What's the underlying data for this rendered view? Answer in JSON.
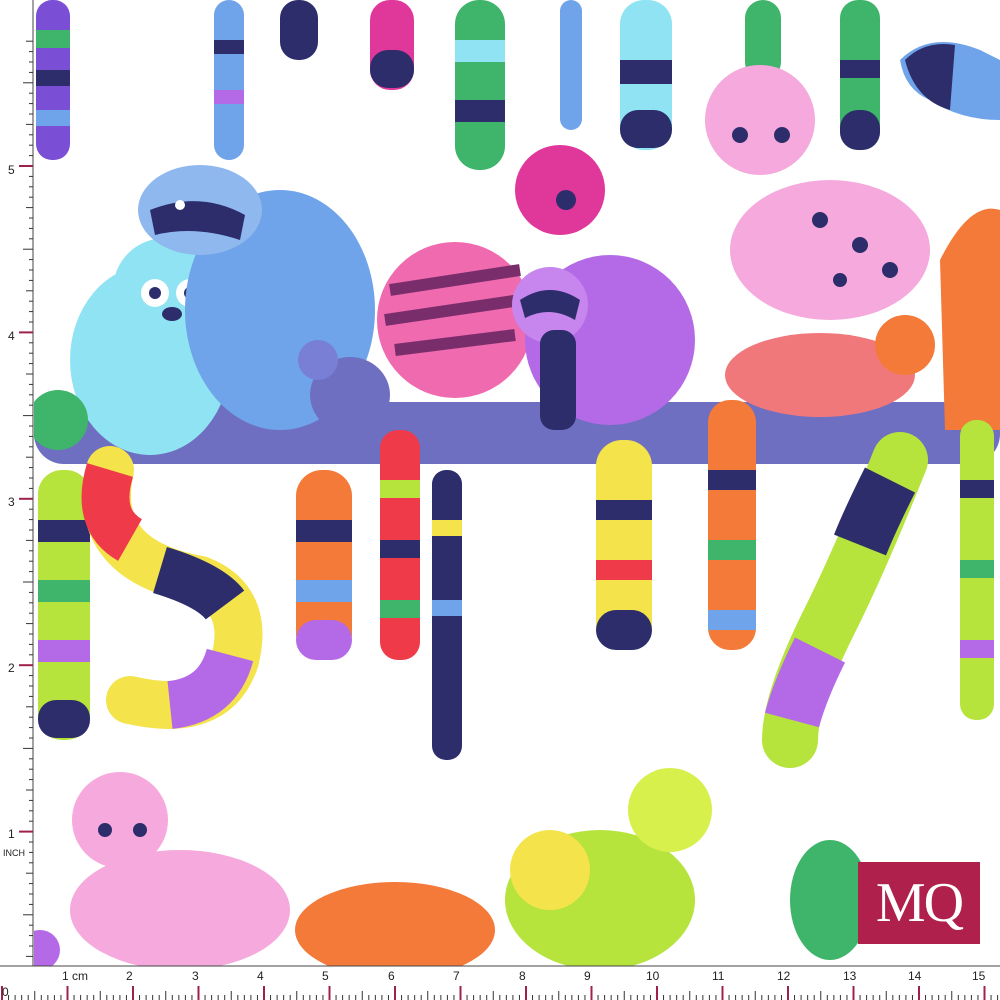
{
  "image": {
    "description_subject": "fabric swatch",
    "palette": {
      "background": "#ffffff",
      "branch": "#6f6fc2",
      "navy": "#2d2d6b",
      "pink": "#f06ab0",
      "magenta": "#e0379b",
      "purple": "#b46ae6",
      "blue": "#6fa4ea",
      "cyan": "#8fe3f2",
      "orange": "#f47a3a",
      "coral": "#f0787a",
      "yellow": "#f4e34a",
      "lime": "#b6e33c",
      "green": "#3fb46b",
      "red": "#ef3a4a"
    }
  },
  "ruler": {
    "inch_unit": "INCH",
    "cm_unit": "cm",
    "inch_marks": [
      "5",
      "4",
      "3",
      "2",
      "1",
      "0"
    ],
    "cm_marks": [
      "1",
      "2",
      "3",
      "4",
      "5",
      "6",
      "7",
      "8",
      "9",
      "10",
      "11",
      "12",
      "13",
      "14",
      "15"
    ]
  },
  "logo": {
    "text": "MQ",
    "color": "#b0204c"
  }
}
